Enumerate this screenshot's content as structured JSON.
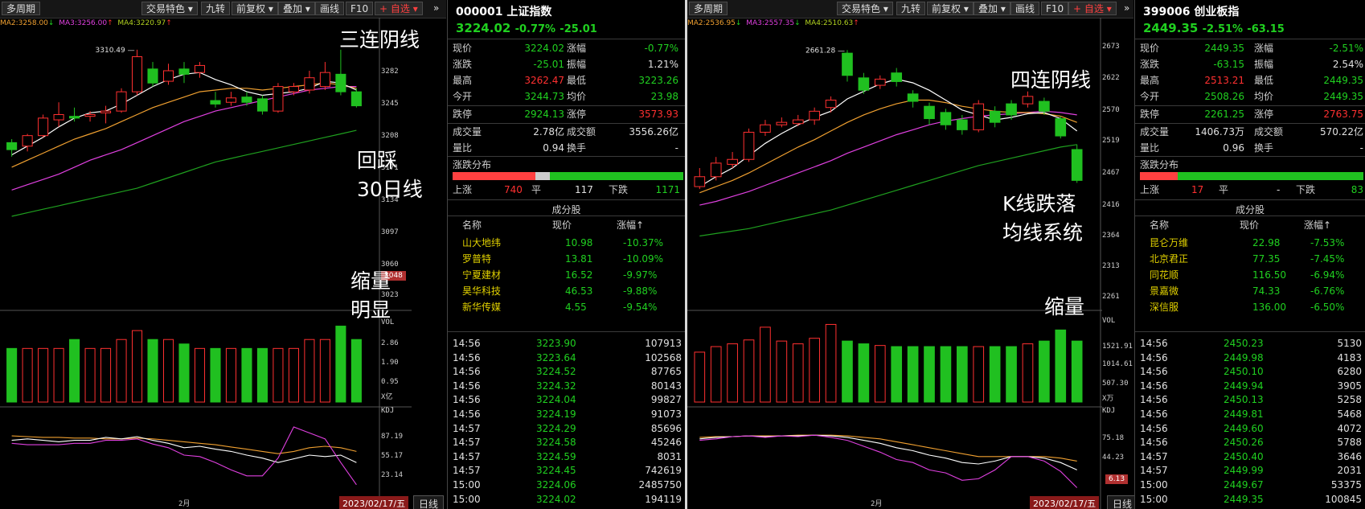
{
  "left": {
    "toolbar": {
      "period": "多周期",
      "trade_feature": "交易特色",
      "jiuzhuan": "九转",
      "fuquan": "前复权",
      "overlay": "叠加",
      "draw": "画线",
      "f10": "F10",
      "watchlist": "+ 自选",
      "more": "»"
    },
    "ma_legend": {
      "ma2": "MA2:3258.00",
      "ma2_arrow": "↓",
      "ma3": "MA3:3256.00",
      "ma3_arrow": "↑",
      "ma4": "MA4:3220.97",
      "ma4_arrow": "↑"
    },
    "high_label": "3310.49",
    "price_axis": [
      "3282",
      "3245",
      "3208",
      "3171",
      "3134",
      "3097",
      "3060",
      "3023"
    ],
    "price_tag": "3048",
    "vol_label": "VOL",
    "vol_axis": [
      "2.86",
      "1.90",
      "0.95"
    ],
    "vol_unit": "X亿",
    "kdj_label": "KDJ",
    "kdj_axis": [
      "87.19",
      "55.17",
      "23.14"
    ],
    "month_label": "2月",
    "date_tag": "2023/02/17/五",
    "day_tab": "日线",
    "annotations": {
      "a1": "三连阴线",
      "a2": "回踩",
      "a3": "30日线",
      "a4": "缩量",
      "a5": "明显"
    },
    "candles": [
      {
        "o": 3204,
        "c": 3196,
        "h": 3208,
        "l": 3188
      },
      {
        "o": 3200,
        "c": 3212,
        "h": 3214,
        "l": 3194
      },
      {
        "o": 3212,
        "c": 3232,
        "h": 3236,
        "l": 3210
      },
      {
        "o": 3230,
        "c": 3236,
        "h": 3250,
        "l": 3222
      },
      {
        "o": 3234,
        "c": 3232,
        "h": 3244,
        "l": 3228
      },
      {
        "o": 3234,
        "c": 3236,
        "h": 3240,
        "l": 3228
      },
      {
        "o": 3238,
        "c": 3240,
        "h": 3246,
        "l": 3226
      },
      {
        "o": 3240,
        "c": 3262,
        "h": 3266,
        "l": 3238
      },
      {
        "o": 3262,
        "c": 3302,
        "h": 3310,
        "l": 3258
      },
      {
        "o": 3288,
        "c": 3272,
        "h": 3296,
        "l": 3268
      },
      {
        "o": 3274,
        "c": 3286,
        "h": 3294,
        "l": 3270
      },
      {
        "o": 3288,
        "c": 3282,
        "h": 3296,
        "l": 3272
      },
      {
        "o": 3284,
        "c": 3292,
        "h": 3296,
        "l": 3278
      },
      {
        "o": 3252,
        "c": 3248,
        "h": 3262,
        "l": 3244
      },
      {
        "o": 3250,
        "c": 3255,
        "h": 3262,
        "l": 3246
      },
      {
        "o": 3256,
        "c": 3250,
        "h": 3262,
        "l": 3246
      },
      {
        "o": 3254,
        "c": 3240,
        "h": 3258,
        "l": 3236
      },
      {
        "o": 3240,
        "c": 3268,
        "h": 3272,
        "l": 3238
      },
      {
        "o": 3262,
        "c": 3268,
        "h": 3272,
        "l": 3258
      },
      {
        "o": 3264,
        "c": 3278,
        "h": 3286,
        "l": 3260
      },
      {
        "o": 3268,
        "c": 3284,
        "h": 3296,
        "l": 3264
      },
      {
        "o": 3282,
        "c": 3262,
        "h": 3310,
        "l": 3258
      },
      {
        "o": 3262,
        "c": 3246,
        "h": 3266,
        "l": 3244
      }
    ],
    "ma5": [
      3190,
      3200,
      3210,
      3222,
      3232,
      3238,
      3240,
      3248,
      3258,
      3268,
      3276,
      3282,
      3284,
      3276,
      3270,
      3262,
      3258,
      3260,
      3262,
      3266,
      3274,
      3272,
      3264
    ],
    "ma10": [
      3176,
      3184,
      3192,
      3200,
      3208,
      3214,
      3220,
      3228,
      3236,
      3244,
      3250,
      3256,
      3262,
      3264,
      3266,
      3266,
      3264,
      3266,
      3268,
      3270,
      3272,
      3270,
      3266
    ],
    "ma20": [
      3150,
      3156,
      3162,
      3168,
      3176,
      3184,
      3190,
      3196,
      3204,
      3212,
      3220,
      3228,
      3234,
      3240,
      3244,
      3248,
      3252,
      3256,
      3260,
      3264,
      3266,
      3268,
      3268
    ],
    "ma30": [
      3120,
      3124,
      3128,
      3132,
      3136,
      3140,
      3144,
      3148,
      3152,
      3158,
      3164,
      3170,
      3176,
      3182,
      3186,
      3190,
      3194,
      3198,
      3202,
      3206,
      3210,
      3214,
      3218
    ],
    "volumes": [
      2.4,
      2.4,
      2.4,
      2.4,
      2.8,
      2.4,
      2.4,
      2.8,
      3.2,
      2.8,
      2.8,
      2.6,
      2.4,
      2.4,
      2.4,
      2.4,
      2.4,
      2.4,
      2.4,
      2.8,
      2.8,
      3.4,
      2.8
    ],
    "kdj_k": [
      70,
      72,
      70,
      68,
      70,
      70,
      74,
      72,
      75,
      70,
      66,
      60,
      62,
      58,
      55,
      50,
      46,
      40,
      45,
      50,
      48,
      50,
      40
    ],
    "kdj_d": [
      76,
      75,
      74,
      74,
      73,
      73,
      72,
      72,
      73,
      72,
      70,
      68,
      66,
      64,
      61,
      58,
      55,
      52,
      55,
      60,
      62,
      60,
      55
    ],
    "kdj_j": [
      66,
      64,
      64,
      64,
      66,
      66,
      70,
      70,
      72,
      65,
      60,
      50,
      48,
      40,
      30,
      22,
      22,
      46,
      88,
      80,
      72,
      40,
      10
    ],
    "side": {
      "title": "000001 上证指数",
      "price": "3224.02",
      "pct": "-0.77%",
      "chg": "-25.01",
      "quote": [
        {
          "l1": "现价",
          "v1": "3224.02",
          "l2": "涨幅",
          "v2": "-0.77%"
        },
        {
          "l1": "涨跌",
          "v1": "-25.01",
          "l2": "振幅",
          "v2": "1.21%"
        },
        {
          "l1": "最高",
          "v1": "3262.47",
          "l2": "最低",
          "v2": "3223.26"
        },
        {
          "l1": "今开",
          "v1": "3244.73",
          "l2": "均价",
          "v2": "23.98"
        },
        {
          "l1": "跌停",
          "v1": "2924.13",
          "l2": "涨停",
          "v2": "3573.93"
        }
      ],
      "vol": {
        "l1": "成交量",
        "v1": "2.78亿",
        "l2": "成交额",
        "v2": "3556.26亿"
      },
      "lb": {
        "l1": "量比",
        "v1": "0.94",
        "l2": "换手",
        "v2": "-"
      },
      "dist_title": "涨跌分布",
      "dist": {
        "up_label": "上涨",
        "up": "740",
        "flat_label": "平",
        "flat": "117",
        "down_label": "下跌",
        "down": "1171",
        "up_frac": 0.36,
        "flat_frac": 0.06,
        "down_frac": 0.58
      },
      "comp_title": "成分股",
      "comp_head": {
        "name": "名称",
        "price": "现价",
        "chg": "涨幅↑"
      },
      "comps": [
        {
          "n": "山大地纬",
          "p": "10.98",
          "c": "-10.37%"
        },
        {
          "n": "罗普特",
          "p": "13.81",
          "c": "-10.09%"
        },
        {
          "n": "宁夏建材",
          "p": "16.52",
          "c": "-9.97%"
        },
        {
          "n": "昊华科技",
          "p": "46.53",
          "c": "-9.88%"
        },
        {
          "n": "新华传媒",
          "p": "4.55",
          "c": "-9.54%"
        }
      ],
      "ticks": [
        {
          "t": "14:56",
          "p": "3223.90",
          "v": "107913"
        },
        {
          "t": "14:56",
          "p": "3223.64",
          "v": "102568"
        },
        {
          "t": "14:56",
          "p": "3224.52",
          "v": "87765"
        },
        {
          "t": "14:56",
          "p": "3224.32",
          "v": "80143"
        },
        {
          "t": "14:56",
          "p": "3224.04",
          "v": "99827"
        },
        {
          "t": "14:56",
          "p": "3224.19",
          "v": "91073"
        },
        {
          "t": "14:57",
          "p": "3224.29",
          "v": "85696"
        },
        {
          "t": "14:57",
          "p": "3224.58",
          "v": "45246"
        },
        {
          "t": "14:57",
          "p": "3224.59",
          "v": "8031"
        },
        {
          "t": "14:57",
          "p": "3224.45",
          "v": "742619"
        },
        {
          "t": "15:00",
          "p": "3224.06",
          "v": "2485750"
        },
        {
          "t": "15:00",
          "p": "3224.02",
          "v": "194119"
        }
      ]
    }
  },
  "right": {
    "toolbar": {
      "period": "多周期",
      "trade_feature": "交易特色",
      "jiuzhuan": "九转",
      "fuquan": "前复权",
      "overlay": "叠加",
      "draw": "画线",
      "f10": "F10",
      "watchlist": "+ 自选",
      "more": "»"
    },
    "ma_legend": {
      "ma2": "MA2:2536.95",
      "ma2_arrow": "↓",
      "ma3": "MA3:2557.35",
      "ma3_arrow": "↓",
      "ma4": "MA4:2510.63",
      "ma4_arrow": "↑"
    },
    "high_label": "2661.28",
    "price_axis": [
      "2673",
      "2622",
      "2570",
      "2519",
      "2467",
      "2416",
      "2364",
      "2313",
      "2261"
    ],
    "vol_label": "VOL",
    "vol_axis": [
      "1521.91",
      "1014.61",
      "507.30"
    ],
    "vol_unit": "X万",
    "kdj_label": "KDJ",
    "kdj_axis": [
      "75.18",
      "44.23"
    ],
    "kdj_tag": "6.13",
    "month_label": "2月",
    "date_tag": "2023/02/17/五",
    "day_tab": "日线",
    "annotations": {
      "a1": "四连阴线",
      "a2": "K线跌落",
      "a3": "均线系统",
      "a4": "缩量"
    },
    "candles": [
      {
        "o": 2440,
        "c": 2456,
        "h": 2470,
        "l": 2436
      },
      {
        "o": 2456,
        "c": 2478,
        "h": 2488,
        "l": 2450
      },
      {
        "o": 2476,
        "c": 2484,
        "h": 2496,
        "l": 2470
      },
      {
        "o": 2484,
        "c": 2528,
        "h": 2534,
        "l": 2480
      },
      {
        "o": 2528,
        "c": 2540,
        "h": 2548,
        "l": 2522
      },
      {
        "o": 2540,
        "c": 2544,
        "h": 2552,
        "l": 2536
      },
      {
        "o": 2542,
        "c": 2548,
        "h": 2556,
        "l": 2538
      },
      {
        "o": 2548,
        "c": 2562,
        "h": 2568,
        "l": 2540
      },
      {
        "o": 2568,
        "c": 2580,
        "h": 2586,
        "l": 2560
      },
      {
        "o": 2656,
        "c": 2620,
        "h": 2661,
        "l": 2610
      },
      {
        "o": 2616,
        "c": 2596,
        "h": 2624,
        "l": 2590
      },
      {
        "o": 2604,
        "c": 2614,
        "h": 2620,
        "l": 2598
      },
      {
        "o": 2624,
        "c": 2610,
        "h": 2632,
        "l": 2602
      },
      {
        "o": 2590,
        "c": 2578,
        "h": 2596,
        "l": 2568
      },
      {
        "o": 2570,
        "c": 2550,
        "h": 2576,
        "l": 2540
      },
      {
        "o": 2560,
        "c": 2540,
        "h": 2566,
        "l": 2532
      },
      {
        "o": 2548,
        "c": 2532,
        "h": 2556,
        "l": 2524
      },
      {
        "o": 2532,
        "c": 2574,
        "h": 2580,
        "l": 2528
      },
      {
        "o": 2562,
        "c": 2544,
        "h": 2570,
        "l": 2536
      },
      {
        "o": 2574,
        "c": 2556,
        "h": 2580,
        "l": 2548
      },
      {
        "o": 2574,
        "c": 2586,
        "h": 2594,
        "l": 2568
      },
      {
        "o": 2578,
        "c": 2562,
        "h": 2584,
        "l": 2556
      },
      {
        "o": 2550,
        "c": 2522,
        "h": 2554,
        "l": 2518
      },
      {
        "o": 2500,
        "c": 2450,
        "h": 2508,
        "l": 2446
      }
    ],
    "ma5": [
      2440,
      2456,
      2470,
      2490,
      2510,
      2526,
      2540,
      2552,
      2562,
      2582,
      2594,
      2606,
      2614,
      2608,
      2596,
      2580,
      2564,
      2556,
      2548,
      2552,
      2558,
      2560,
      2550,
      2530
    ],
    "ma10": [
      2430,
      2440,
      2450,
      2462,
      2476,
      2490,
      2504,
      2516,
      2530,
      2544,
      2556,
      2566,
      2574,
      2580,
      2580,
      2576,
      2570,
      2566,
      2562,
      2560,
      2560,
      2558,
      2554,
      2544
    ],
    "ma20": [
      2410,
      2416,
      2424,
      2432,
      2442,
      2452,
      2462,
      2472,
      2482,
      2494,
      2504,
      2514,
      2524,
      2532,
      2540,
      2546,
      2550,
      2554,
      2556,
      2558,
      2560,
      2562,
      2560,
      2556
    ],
    "ma30": [
      2360,
      2364,
      2368,
      2372,
      2378,
      2384,
      2390,
      2396,
      2402,
      2410,
      2418,
      2426,
      2434,
      2442,
      2450,
      2458,
      2466,
      2474,
      2480,
      2486,
      2492,
      2498,
      2504,
      2508
    ],
    "volumes": [
      900,
      1000,
      1050,
      1120,
      1350,
      1100,
      1050,
      1150,
      1400,
      1100,
      1050,
      1020,
      1000,
      1000,
      1000,
      1000,
      1000,
      1000,
      1000,
      1000,
      1050,
      1100,
      1300,
      1100
    ],
    "kdj_k": [
      72,
      74,
      75,
      76,
      75,
      76,
      76,
      77,
      76,
      74,
      70,
      66,
      60,
      56,
      50,
      46,
      40,
      38,
      42,
      48,
      48,
      46,
      40,
      30
    ],
    "kdj_d": [
      74,
      75,
      75,
      76,
      76,
      76,
      77,
      77,
      77,
      76,
      74,
      72,
      68,
      64,
      60,
      56,
      52,
      48,
      48,
      48,
      48,
      48,
      46,
      42
    ],
    "kdj_j": [
      70,
      72,
      75,
      76,
      74,
      76,
      75,
      77,
      74,
      70,
      62,
      54,
      44,
      40,
      30,
      26,
      16,
      18,
      30,
      48,
      48,
      42,
      28,
      6
    ],
    "side": {
      "title": "399006 创业板指",
      "price": "2449.35",
      "pct": "-2.51%",
      "chg": "-63.15",
      "quote": [
        {
          "l1": "现价",
          "v1": "2449.35",
          "l2": "涨幅",
          "v2": "-2.51%"
        },
        {
          "l1": "涨跌",
          "v1": "-63.15",
          "l2": "振幅",
          "v2": "2.54%"
        },
        {
          "l1": "最高",
          "v1": "2513.21",
          "l2": "最低",
          "v2": "2449.35"
        },
        {
          "l1": "今开",
          "v1": "2508.26",
          "l2": "均价",
          "v2": "2449.35"
        },
        {
          "l1": "跌停",
          "v1": "2261.25",
          "l2": "涨停",
          "v2": "2763.75"
        }
      ],
      "vol": {
        "l1": "成交量",
        "v1": "1406.73万",
        "l2": "成交额",
        "v2": "570.22亿"
      },
      "lb": {
        "l1": "量比",
        "v1": "0.96",
        "l2": "换手",
        "v2": "-"
      },
      "dist_title": "涨跌分布",
      "dist": {
        "up_label": "上涨",
        "up": "17",
        "flat_label": "平",
        "flat": "-",
        "down_label": "下跌",
        "down": "83",
        "up_frac": 0.17,
        "flat_frac": 0.0,
        "down_frac": 0.83
      },
      "comp_title": "成分股",
      "comp_head": {
        "name": "名称",
        "price": "现价",
        "chg": "涨幅↑"
      },
      "comps": [
        {
          "n": "昆仑万维",
          "p": "22.98",
          "c": "-7.53%"
        },
        {
          "n": "北京君正",
          "p": "77.35",
          "c": "-7.45%"
        },
        {
          "n": "同花顺",
          "p": "116.50",
          "c": "-6.94%"
        },
        {
          "n": "景嘉微",
          "p": "74.33",
          "c": "-6.76%"
        },
        {
          "n": "深信服",
          "p": "136.00",
          "c": "-6.50%"
        }
      ],
      "ticks": [
        {
          "t": "14:56",
          "p": "2450.23",
          "v": "5130"
        },
        {
          "t": "14:56",
          "p": "2449.98",
          "v": "4183"
        },
        {
          "t": "14:56",
          "p": "2450.10",
          "v": "6280"
        },
        {
          "t": "14:56",
          "p": "2449.94",
          "v": "3905"
        },
        {
          "t": "14:56",
          "p": "2450.13",
          "v": "5258"
        },
        {
          "t": "14:56",
          "p": "2449.81",
          "v": "5468"
        },
        {
          "t": "14:56",
          "p": "2449.60",
          "v": "4072"
        },
        {
          "t": "14:56",
          "p": "2450.26",
          "v": "5788"
        },
        {
          "t": "14:57",
          "p": "2450.40",
          "v": "3646"
        },
        {
          "t": "14:57",
          "p": "2449.99",
          "v": "2031"
        },
        {
          "t": "15:00",
          "p": "2449.67",
          "v": "53375"
        },
        {
          "t": "15:00",
          "p": "2449.35",
          "v": "100845"
        }
      ]
    }
  }
}
